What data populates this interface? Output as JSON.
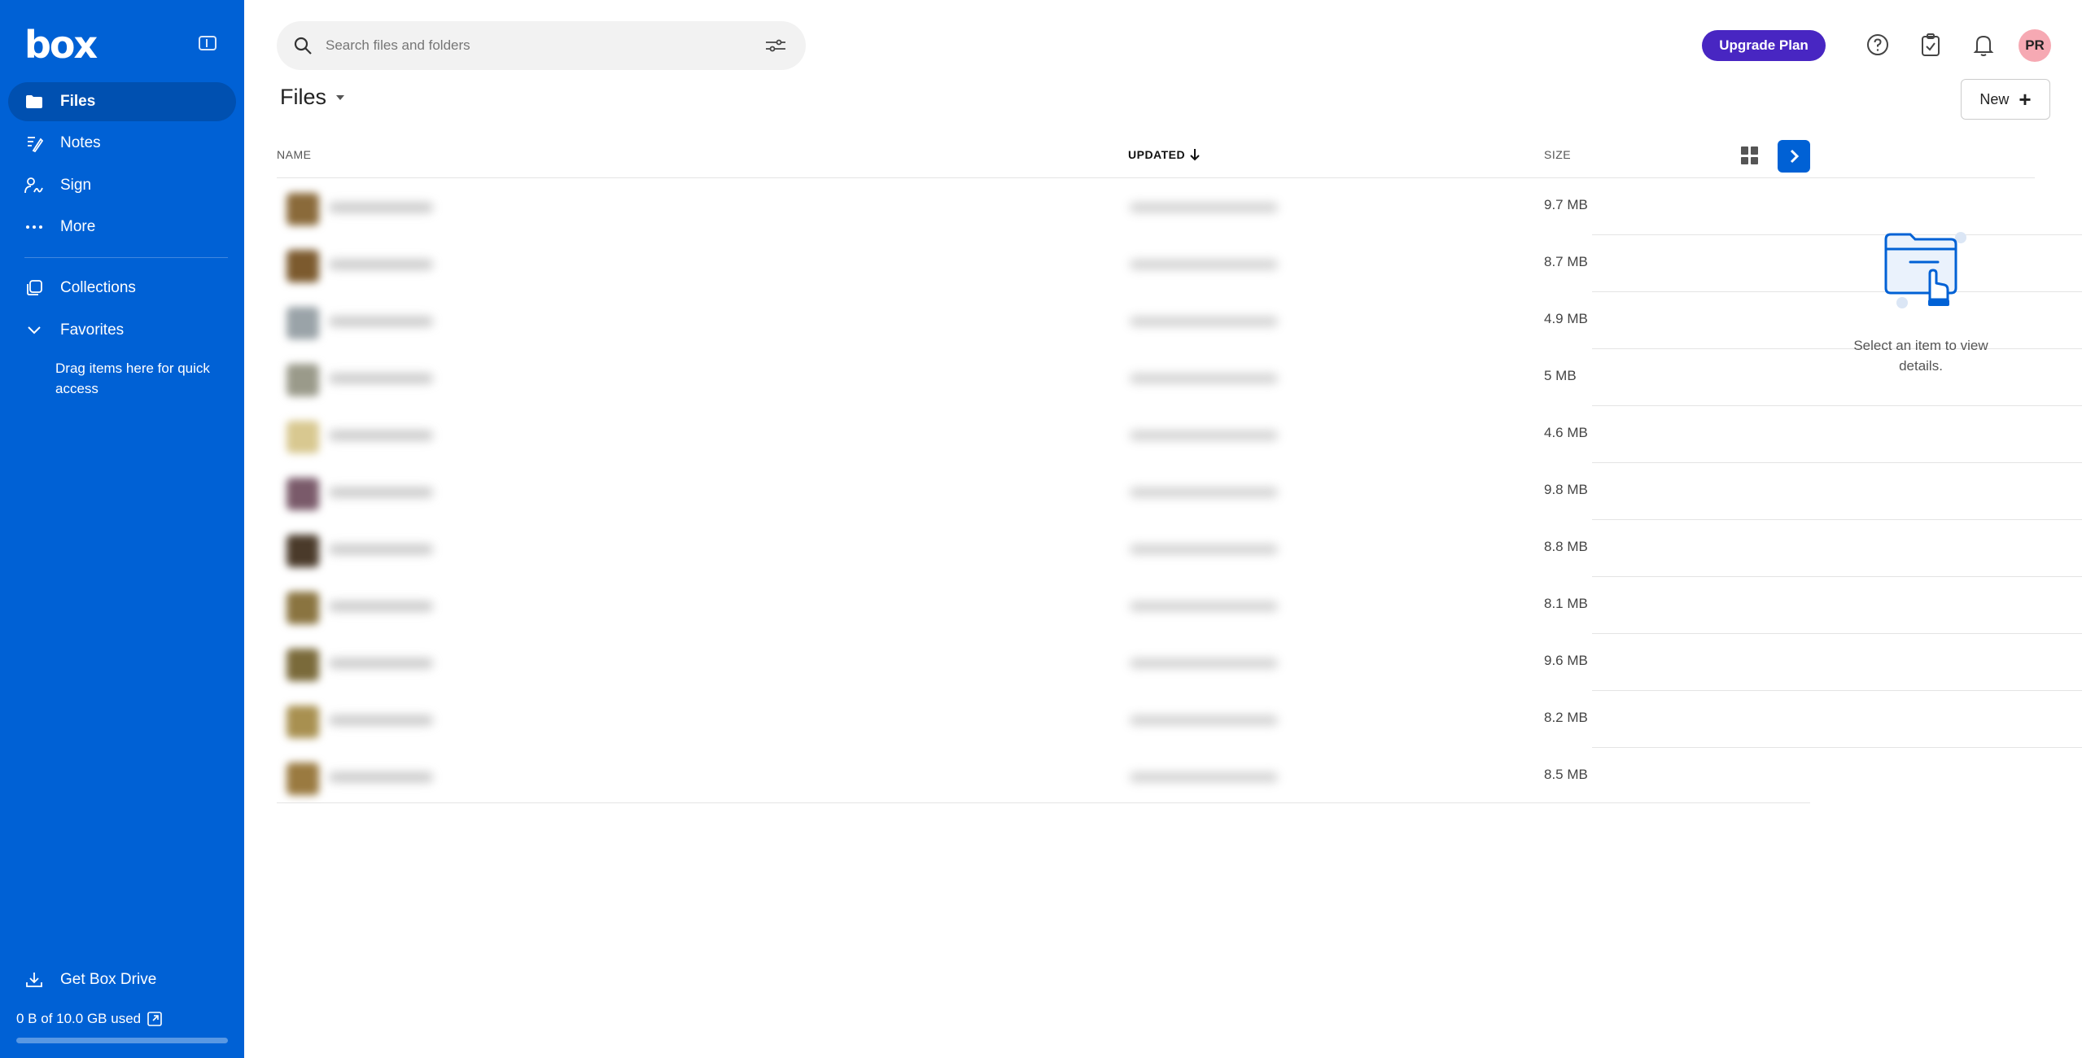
{
  "brand": {
    "logo": "box",
    "color": "#0061d5",
    "upgrade_color": "#4826c2"
  },
  "sidebar": {
    "items": [
      {
        "label": "Files",
        "icon": "folder-icon",
        "active": true
      },
      {
        "label": "Notes",
        "icon": "notes-icon"
      },
      {
        "label": "Sign",
        "icon": "sign-icon"
      },
      {
        "label": "More",
        "icon": "more-icon"
      }
    ],
    "collections_label": "Collections",
    "favorites_label": "Favorites",
    "favorites_hint": "Drag items here for quick access",
    "get_drive_label": "Get Box Drive",
    "storage_label": "0 B of 10.0 GB used",
    "storage_fraction": 0.0
  },
  "header": {
    "search_placeholder": "Search files and folders",
    "upgrade_label": "Upgrade Plan",
    "avatar_initials": "PR"
  },
  "page": {
    "title": "Files",
    "new_label": "New"
  },
  "table": {
    "columns": {
      "name": "NAME",
      "updated": "UPDATED",
      "size": "SIZE"
    },
    "sort": "updated-desc",
    "rows": [
      {
        "size": "9.7 MB",
        "thumb_color": "#8a6a3a"
      },
      {
        "size": "8.7 MB",
        "thumb_color": "#7c5a2e"
      },
      {
        "size": "4.9 MB",
        "thumb_color": "#9aa3a8"
      },
      {
        "size": "5 MB",
        "thumb_color": "#9a9a8a"
      },
      {
        "size": "4.6 MB",
        "thumb_color": "#d8c890"
      },
      {
        "size": "9.8 MB",
        "thumb_color": "#7a5a6a"
      },
      {
        "size": "8.8 MB",
        "thumb_color": "#4a3a2a"
      },
      {
        "size": "8.1 MB",
        "thumb_color": "#8a7440"
      },
      {
        "size": "9.6 MB",
        "thumb_color": "#7a6a3a"
      },
      {
        "size": "8.2 MB",
        "thumb_color": "#a89050"
      },
      {
        "size": "8.5 MB",
        "thumb_color": "#9a7a40"
      }
    ]
  },
  "details": {
    "empty_text": "Select an item to view details."
  }
}
